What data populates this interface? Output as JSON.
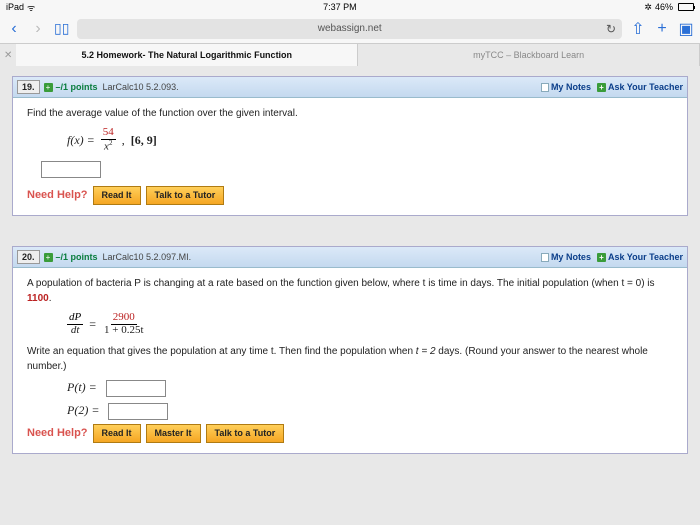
{
  "status": {
    "device": "iPad",
    "time": "7:37 PM",
    "batteryPct": "46%"
  },
  "nav": {
    "url": "webassign.net"
  },
  "tabs": {
    "active": "5.2 Homework- The Natural Logarithmic Function",
    "other": "myTCC – Blackboard Learn"
  },
  "q19": {
    "num": "19.",
    "points": "–/1 points",
    "ref": "LarCalc10 5.2.093.",
    "notes": "My Notes",
    "ask": "Ask Your Teacher",
    "prompt": "Find the average value of the function over the given interval.",
    "fx": "f(x) =",
    "fracNum": "54",
    "fracDen": "x",
    "comma": ",",
    "interval": "[6, 9]",
    "needHelp": "Need Help?",
    "readIt": "Read It",
    "talk": "Talk to a Tutor"
  },
  "q20": {
    "num": "20.",
    "points": "–/1 points",
    "ref": "LarCalc10 5.2.097.MI.",
    "notes": "My Notes",
    "ask": "Ask Your Teacher",
    "prompt1": "A population of bacteria P is changing at a rate based on the function given below, where t is time in days. The initial population (when  t = 0)  is ",
    "initPop": "1100",
    "dot1": ".",
    "dP": "dP",
    "dt": "dt",
    "eq": "=",
    "fracNum": "2900",
    "fracDen": "1 + 0.25t",
    "prompt2a": "Write an equation that gives the population at any time t. Then find the population when  ",
    "tval": "t = 2",
    "prompt2b": "  days. (Round your answer to the nearest whole number.)",
    "Pt": "P(t)  =",
    "P2": "P(2)  =",
    "needHelp": "Need Help?",
    "readIt": "Read It",
    "masterIt": "Master It",
    "talk": "Talk to a Tutor"
  }
}
